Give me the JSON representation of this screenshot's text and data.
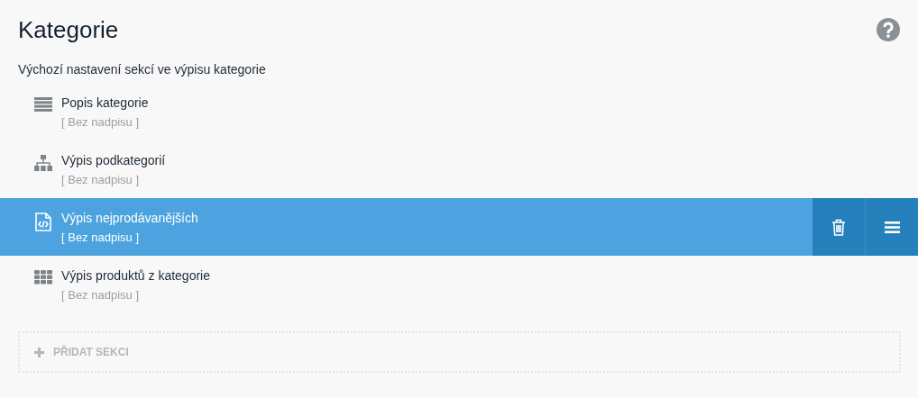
{
  "header": {
    "title": "Kategorie"
  },
  "description": "Výchozí nastavení sekcí ve výpisu kategorie",
  "sections": [
    {
      "kind": "text",
      "title": "Popis kategorie",
      "subtitle": "[ Bez nadpisu ]",
      "selected": false
    },
    {
      "kind": "tree",
      "title": "Výpis podkategorií",
      "subtitle": "[ Bez nadpisu ]",
      "selected": false
    },
    {
      "kind": "code",
      "title": "Výpis nejprodávanějších",
      "subtitle": "[ Bez nadpisu ]",
      "selected": true
    },
    {
      "kind": "grid",
      "title": "Výpis produktů z kategorie",
      "subtitle": "[ Bez nadpisu ]",
      "selected": false
    }
  ],
  "add_button": {
    "label": "PŘIDAT SEKCI"
  }
}
